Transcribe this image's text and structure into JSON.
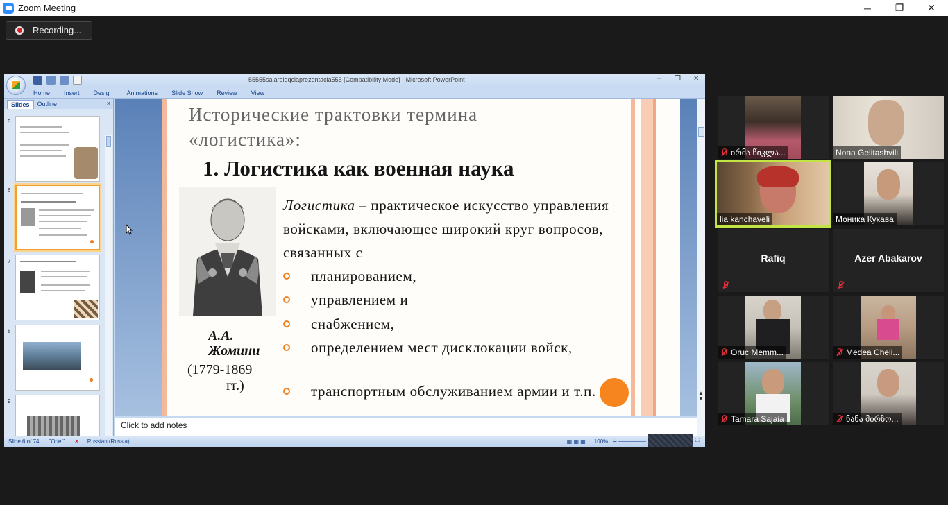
{
  "window": {
    "title": "Zoom Meeting",
    "minimize": "─",
    "restore": "❐",
    "close": "✕"
  },
  "recording": {
    "label": "Recording..."
  },
  "powerpoint": {
    "doc_title": "55555sajaroleqciaprezentacia555 [Compatibility Mode] - Microsoft PowerPoint",
    "ribbon_tabs": [
      "Home",
      "Insert",
      "Design",
      "Animations",
      "Slide Show",
      "Review",
      "View"
    ],
    "pane_tabs": [
      "Slides",
      "Outline"
    ],
    "pane_close": "×",
    "thumb_numbers": [
      "5",
      "6",
      "7",
      "8",
      "9"
    ],
    "notes_placeholder": "Click to add notes",
    "status": {
      "slide": "Slide 6 of 74",
      "theme": "\"Oriel\"",
      "language": "Russian (Russia)",
      "zoom": "100%"
    }
  },
  "slide": {
    "title": "Исторические трактовки термина «логистика»:",
    "heading": "1. Логистика как военная наука",
    "person_name_1": "А.А.",
    "person_name_2": "Жомини",
    "person_years_1": "(1779-1869",
    "person_years_2": "гг.)",
    "definition_term": "Логистика",
    "definition_rest": " – практическое искусство управления войсками, включающее широкий круг вопросов, связанных с",
    "bullets": [
      "планированием,",
      " управлением и",
      "снабжением,",
      "определением мест дисклокации войск,",
      "транспортным обслуживанием армии и т.п."
    ]
  },
  "participants": [
    {
      "name": "ირმა წიკლა...",
      "muted": true
    },
    {
      "name": "Nona Gelitashvili",
      "muted": false
    },
    {
      "name": "lia kanchaveli",
      "muted": false,
      "speaking": true
    },
    {
      "name": "Моника Кукава",
      "muted": false
    },
    {
      "name": "Rafiq",
      "muted": true
    },
    {
      "name": "Azer Abakarov",
      "muted": true
    },
    {
      "name": "Oruc Memm...",
      "muted": true
    },
    {
      "name": "Medea Cheli...",
      "muted": true
    },
    {
      "name": "Tamara Sajaia",
      "muted": true
    },
    {
      "name": "ნანა მირზო...",
      "muted": true
    }
  ],
  "colors": {
    "accent_orange": "#f6841f",
    "active_speaker": "#c2e545",
    "mute_red": "#e0303a",
    "zoom_blue": "#2d8cff"
  }
}
